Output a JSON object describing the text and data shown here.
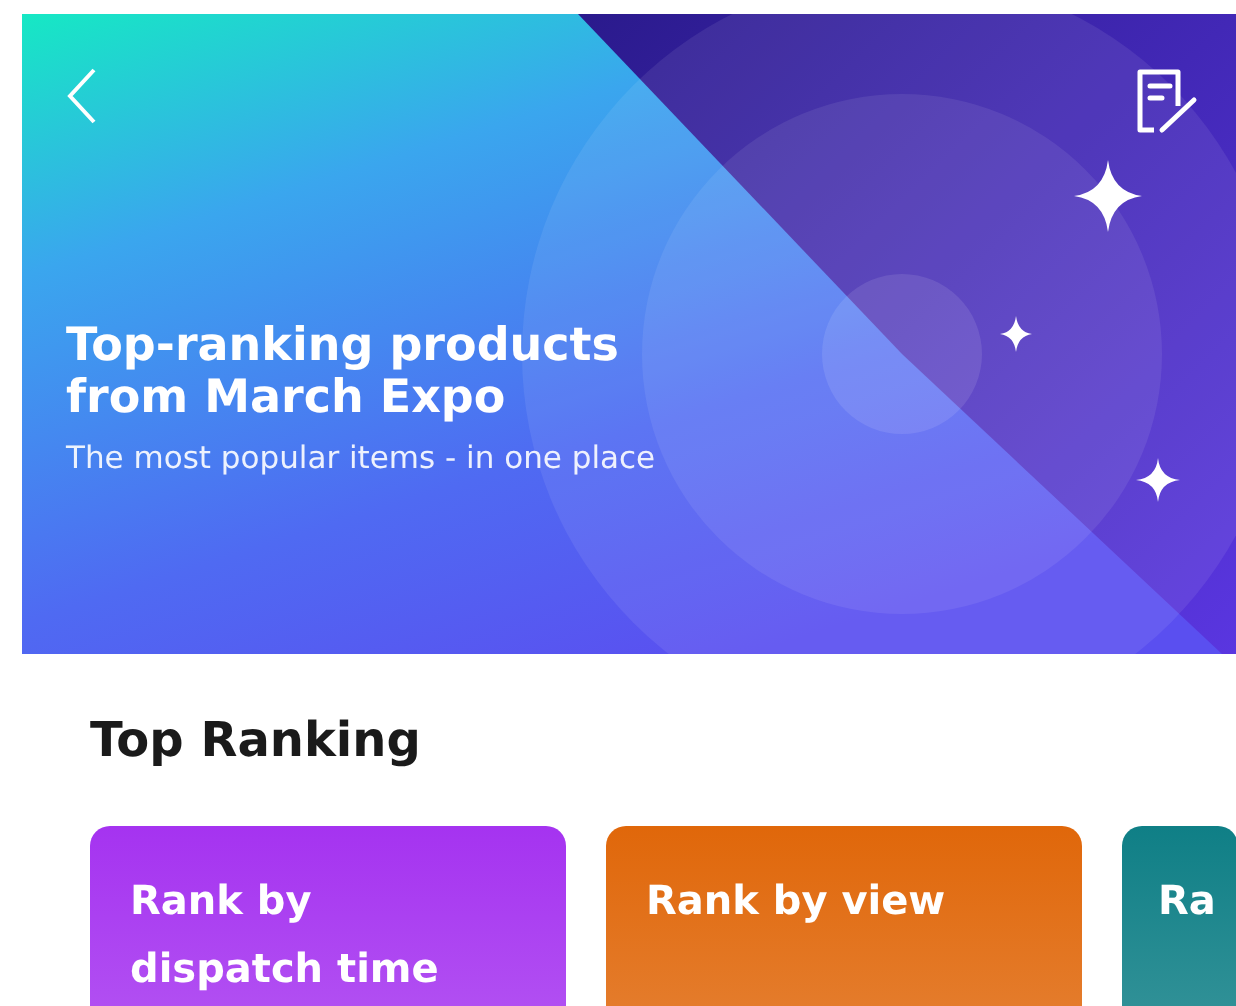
{
  "banner": {
    "title": "Top-ranking products from March Expo",
    "subtitle": "The most popular items - in one place"
  },
  "section": {
    "title": "Top Ranking"
  },
  "cards": [
    {
      "label": "Rank by dispatch time",
      "color": "#a533f0"
    },
    {
      "label": "Rank by view",
      "color": "#e0670a"
    },
    {
      "label": "Ra",
      "color": "#0f7f86"
    }
  ]
}
